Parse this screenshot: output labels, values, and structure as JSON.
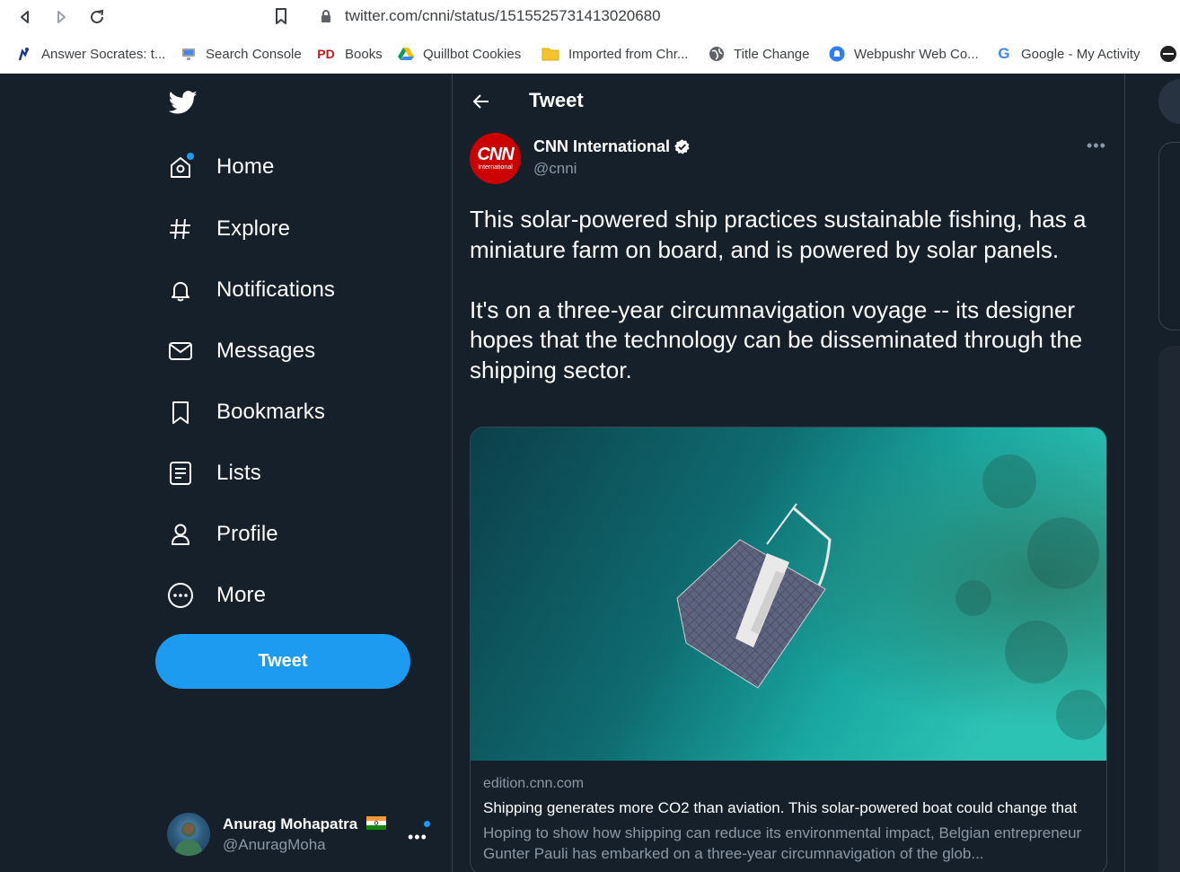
{
  "browser": {
    "url": "twitter.com/cnni/status/1515525731413020680",
    "bookmarks": [
      {
        "label": "Answer Socrates: t...",
        "icon": "socrates-icon"
      },
      {
        "label": "Search Console",
        "icon": "search-console-icon"
      },
      {
        "label": "Books",
        "icon": "pd-icon"
      },
      {
        "label": "Quillbot Cookies",
        "icon": "drive-icon"
      },
      {
        "label": "Imported from Chr...",
        "icon": "folder-icon"
      },
      {
        "label": "Title Change",
        "icon": "globe-icon"
      },
      {
        "label": "Webpushr Web Co...",
        "icon": "webpushr-icon"
      },
      {
        "label": "Google - My Activity",
        "icon": "google-icon"
      }
    ]
  },
  "sidebar": {
    "items": [
      {
        "label": "Home",
        "icon": "home-icon"
      },
      {
        "label": "Explore",
        "icon": "hashtag-icon"
      },
      {
        "label": "Notifications",
        "icon": "bell-icon"
      },
      {
        "label": "Messages",
        "icon": "envelope-icon"
      },
      {
        "label": "Bookmarks",
        "icon": "bookmark-icon"
      },
      {
        "label": "Lists",
        "icon": "list-icon"
      },
      {
        "label": "Profile",
        "icon": "person-icon"
      },
      {
        "label": "More",
        "icon": "more-circle-icon"
      }
    ],
    "tweet_button": "Tweet",
    "account": {
      "name": "Anurag Mohapatra",
      "handle": "@AnuragMoha"
    }
  },
  "header": {
    "title": "Tweet"
  },
  "tweet": {
    "author": {
      "name": "CNN International",
      "handle": "@cnni",
      "avatar_text": "CNN",
      "avatar_subtext": "International"
    },
    "text": "This solar-powered ship practices sustainable fishing, has a miniature farm on board, and is powered by solar panels.\n\nIt's on a three-year circumnavigation voyage -- its designer hopes that the technology can be disseminated through the shipping sector.",
    "card": {
      "domain": "edition.cnn.com",
      "title": "Shipping generates more CO2 than aviation. This solar-powered boat could change that",
      "description": "Hoping to show how shipping can reduce its environmental impact, Belgian entrepreneur Gunter Pauli has embarked on a three-year circumnavigation of the glob..."
    }
  },
  "colors": {
    "background": "#15202b",
    "accent": "#1d9bf0",
    "border": "#38444d",
    "secondary_text": "#8b98a5",
    "cnn_red": "#cc0000"
  }
}
